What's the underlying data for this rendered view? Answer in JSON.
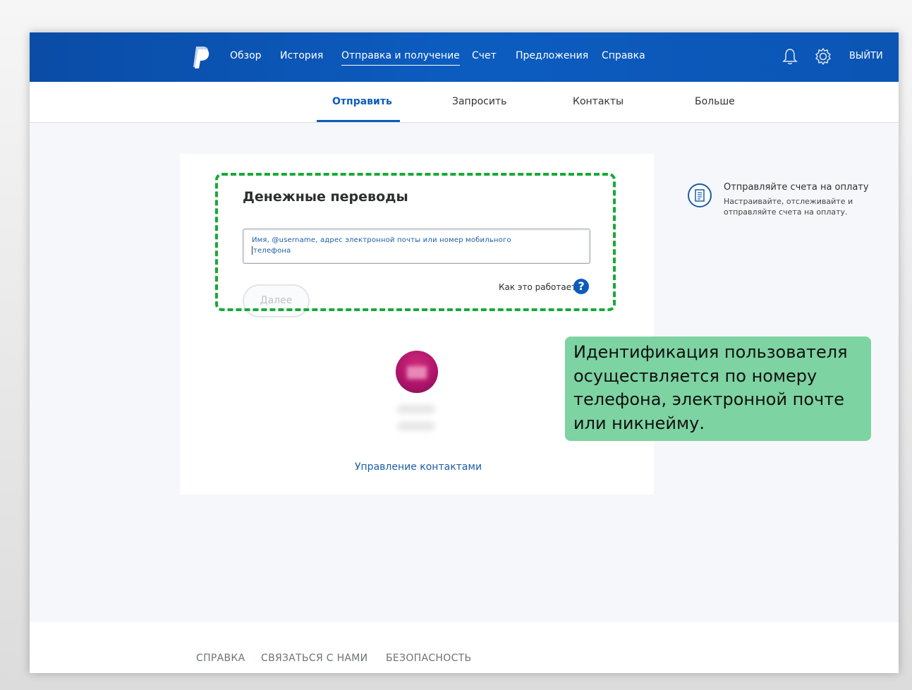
{
  "topnav": {
    "items": [
      {
        "label": "Обзор"
      },
      {
        "label": "История"
      },
      {
        "label": "Отправка и получение"
      },
      {
        "label": "Счет"
      },
      {
        "label": "Предложения"
      },
      {
        "label": "Справка"
      }
    ],
    "active_item": "Отправка и получение",
    "logout_label": "ВЫЙТИ",
    "icons": [
      "paypal-logo",
      "bell-icon",
      "gear-icon"
    ],
    "brand_color": "#0c5cbd"
  },
  "subnav": {
    "items": [
      {
        "label": "Отправить"
      },
      {
        "label": "Запросить"
      },
      {
        "label": "Контакты"
      },
      {
        "label": "Больше"
      }
    ],
    "active_item": "Отправить"
  },
  "send_card": {
    "title": "Денежные переводы",
    "recipient_placeholder_line1": "Имя, @username, адрес электронной почты или номер мобильного",
    "recipient_placeholder_line2": "телефона",
    "next_button_label": "Далее",
    "how_it_works_label": "Как это работает",
    "help_icon_glyph": "?",
    "manage_contacts_label": "Управление контактами",
    "highlight_color": "#18a93a"
  },
  "invoice_promo": {
    "title": "Отправляйте счета на оплату",
    "description": "Настраивайте, отслеживайте и отправляйте счета на оплату.",
    "icon": "invoice-icon"
  },
  "callout": {
    "text": "Идентификация пользователя осуществляется по номеру телефона, электронной почте или никнейму.",
    "background_color": "#7dd3a2"
  },
  "footer": {
    "links": [
      {
        "label": "СПРАВКА"
      },
      {
        "label": "СВЯЗАТЬСЯ С НАМИ"
      },
      {
        "label": "БЕЗОПАСНОСТЬ"
      }
    ]
  }
}
